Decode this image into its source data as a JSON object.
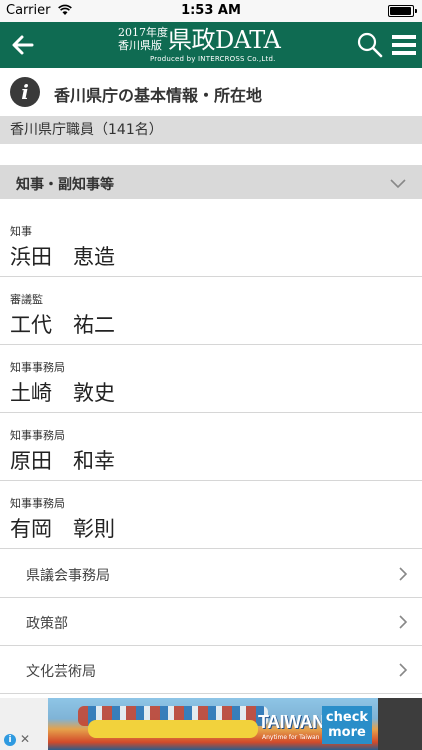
{
  "status_bar": {
    "carrier": "Carrier",
    "time": "1:53 AM"
  },
  "nav": {
    "logo_line1": "2017年度",
    "logo_line2": "香川県版",
    "logo_main": "県政DATA",
    "logo_produced": "Produced by INTERCROSS Co.,Ltd.",
    "accent_color": "#0f6b52"
  },
  "info_header": {
    "title": "香川県庁の基本情報・所在地"
  },
  "staff_count": "香川県庁職員（141名）",
  "section": {
    "label": "知事・副知事等"
  },
  "people": [
    {
      "role": "知事",
      "name": "浜田　恵造"
    },
    {
      "role": "審議監",
      "name": "工代　祐二"
    },
    {
      "role": "知事事務局",
      "name": "土崎　敦史"
    },
    {
      "role": "知事事務局",
      "name": "原田　和幸"
    },
    {
      "role": "知事事務局",
      "name": "有岡　彰則"
    }
  ],
  "departments": [
    {
      "label": "県議会事務局"
    },
    {
      "label": "政策部"
    },
    {
      "label": "文化芸術局"
    }
  ],
  "ad": {
    "brand": "TAIWAN",
    "tagline": "Anytime for Taiwan",
    "cta": "check more"
  }
}
